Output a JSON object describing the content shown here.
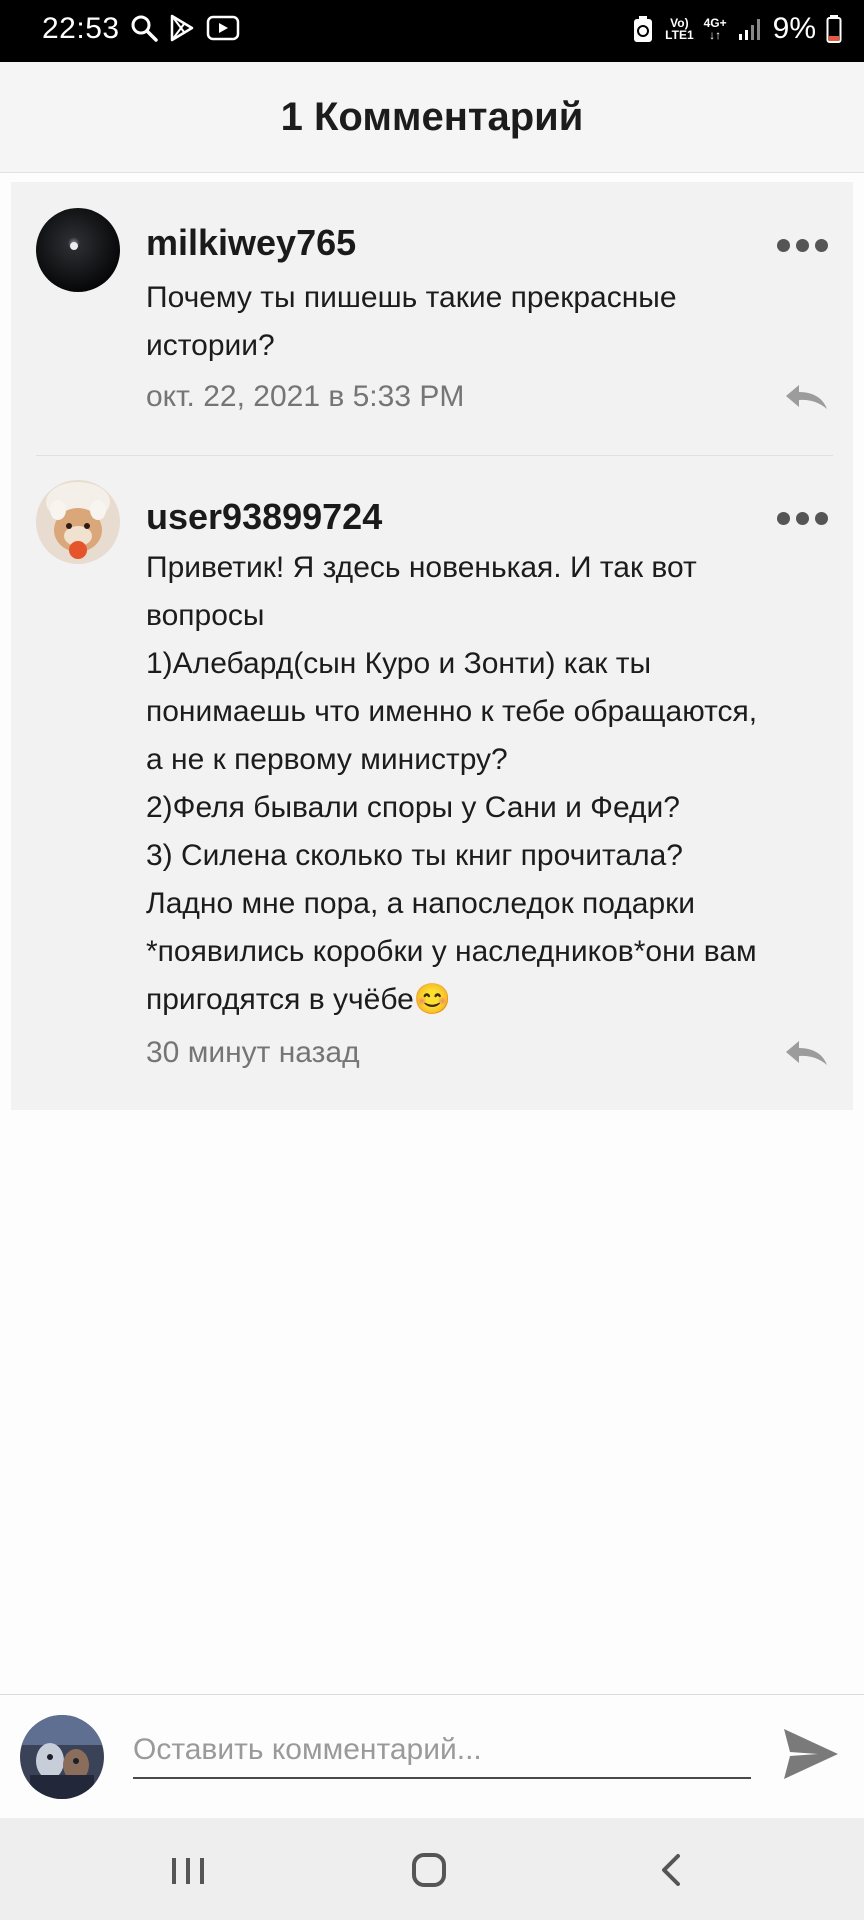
{
  "status_bar": {
    "time": "22:53",
    "left_icons": [
      "search-icon",
      "play-store-icon",
      "youtube-icon"
    ],
    "net_top": "Vo)",
    "net_bottom": "LTE1",
    "net_type": "4G+",
    "battery_percent": "9%"
  },
  "header": {
    "title": "1 Комментарий"
  },
  "comments": [
    {
      "username": "milkiwey765",
      "text": "Почему ты пишешь такие прекрасные\nистории?",
      "timestamp": "окт. 22, 2021 в 5:33 PM"
    },
    {
      "username": "user93899724",
      "text": "Приветик! Я здесь новенькая. И так вот\nвопросы\n1)Алебард(сын Куро и Зонти) как ты\nпонимаешь что именно к тебе обращаются,\nа не к первому министру?\n2)Феля бывали споры у Сани и Феди?\n3) Силена сколько ты книг прочитала?\nЛадно мне пора, а напоследок подарки\n*появились коробки у наследников*они вам\nпригодятся в учёбе😊",
      "timestamp": "30 минут назад"
    }
  ],
  "compose": {
    "placeholder": "Оставить комментарий..."
  },
  "colors": {
    "accent": "#1a1a1a",
    "muted": "#757575",
    "panel": "#f2f2f2"
  }
}
